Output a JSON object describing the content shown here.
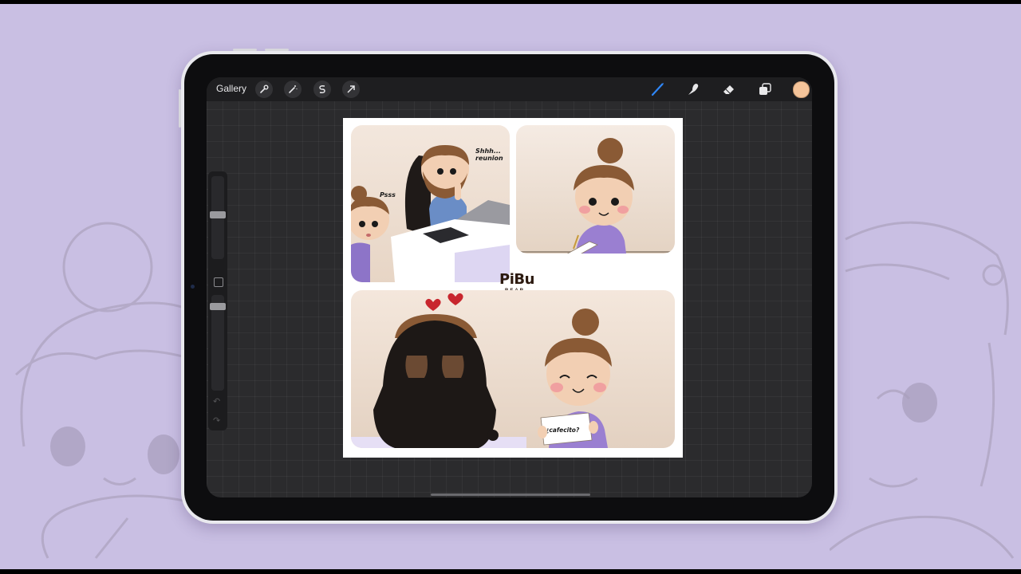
{
  "toolbar": {
    "gallery_label": "Gallery",
    "left_tools": [
      "wrench-icon",
      "magic-wand-icon",
      "selection-icon",
      "transform-icon"
    ],
    "right_tools": [
      "brush-icon",
      "smudge-icon",
      "eraser-icon",
      "layers-icon"
    ],
    "active_tool": "brush-icon",
    "current_color": "#f5c49a",
    "accent_color": "#2f86f6"
  },
  "comic": {
    "panel1": {
      "speech_whisper": "Psss",
      "speech_boss": "Shhh... reunion"
    },
    "logo": {
      "main": "PiBu",
      "sub": "BEAR"
    },
    "panel3": {
      "sign_text": "¿cafecito?"
    }
  }
}
